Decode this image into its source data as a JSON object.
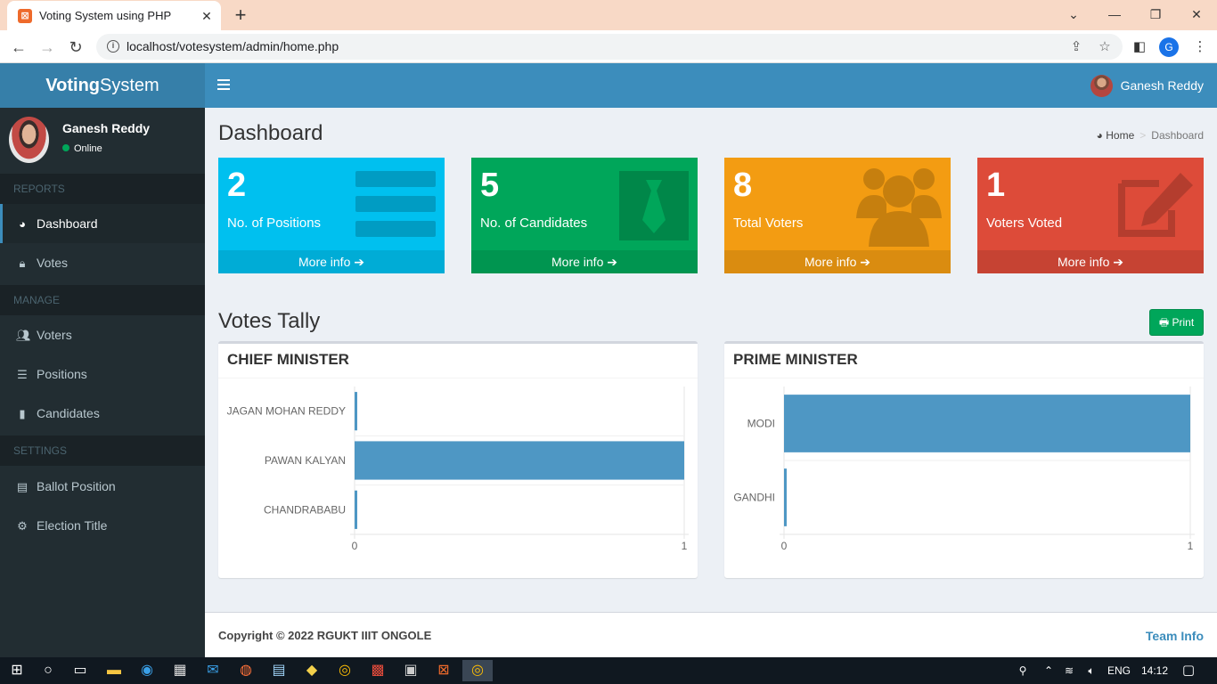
{
  "browser": {
    "tab_title": "Voting System using PHP",
    "tab_favicon": "xampp-icon",
    "url": "localhost/votesystem/admin/home.php",
    "profile_initial": "G"
  },
  "app": {
    "logo_bold": "Voting",
    "logo_rest": "System",
    "nav_user": "Ganesh Reddy"
  },
  "sidebar": {
    "user_name": "Ganesh Reddy",
    "user_status": "Online",
    "sections": {
      "reports": "REPORTS",
      "manage": "MANAGE",
      "settings": "SETTINGS"
    },
    "items": {
      "dashboard": "Dashboard",
      "votes": "Votes",
      "voters": "Voters",
      "positions": "Positions",
      "candidates": "Candidates",
      "ballot_position": "Ballot Position",
      "election_title": "Election Title"
    }
  },
  "content": {
    "page_title": "Dashboard",
    "breadcrumb_home": "Home",
    "breadcrumb_current": "Dashboard",
    "boxes": {
      "positions": {
        "value": "2",
        "label": "No. of Positions",
        "footer": "More info",
        "color": "#00c0ef"
      },
      "candidates": {
        "value": "5",
        "label": "No. of Candidates",
        "footer": "More info",
        "color": "#00a65a"
      },
      "voters": {
        "value": "8",
        "label": "Total Voters",
        "footer": "More info",
        "color": "#f39c12"
      },
      "voted": {
        "value": "1",
        "label": "Voters Voted",
        "footer": "More info",
        "color": "#dd4b39"
      }
    },
    "tally_title": "Votes Tally",
    "print_label": "Print"
  },
  "chart_data": [
    {
      "type": "bar",
      "orientation": "horizontal",
      "title": "CHIEF MINISTER",
      "categories": [
        "JAGAN MOHAN REDDY",
        "PAWAN KALYAN",
        "CHANDRABABU"
      ],
      "values": [
        0,
        1,
        0
      ],
      "xlim": [
        0,
        1
      ],
      "ticks": [
        "0",
        "1"
      ],
      "color": "#4e97c4",
      "grid": true
    },
    {
      "type": "bar",
      "orientation": "horizontal",
      "title": "PRIME MINISTER",
      "categories": [
        "MODI",
        "GANDHI"
      ],
      "values": [
        1,
        0
      ],
      "xlim": [
        0,
        1
      ],
      "ticks": [
        "0",
        "1"
      ],
      "color": "#4e97c4",
      "grid": true
    }
  ],
  "footer": {
    "copyright": "Copyright © 2022 RGUKT IIIT ONGOLE",
    "team_info": "Team Info"
  },
  "taskbar": {
    "language": "ENG",
    "time": "14:12"
  }
}
